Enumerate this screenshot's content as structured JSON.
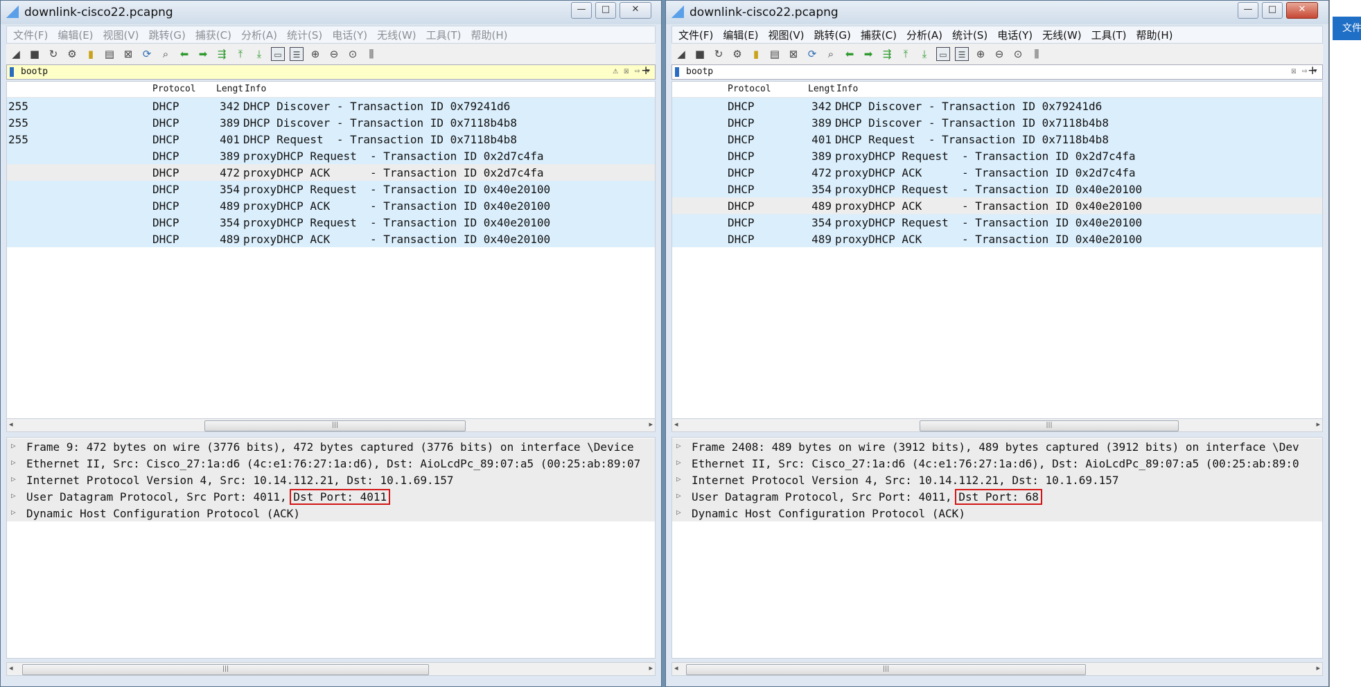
{
  "left": {
    "title": "downlink-cisco22.pcapng",
    "menu": [
      "文件(F)",
      "编辑(E)",
      "视图(V)",
      "跳转(G)",
      "捕获(C)",
      "分析(A)",
      "统计(S)",
      "电话(Y)",
      "无线(W)",
      "工具(T)",
      "帮助(H)"
    ],
    "filter": "bootp",
    "columns": {
      "protocol": "Protocol",
      "length": "Lengt",
      "info": "Info"
    },
    "rows": [
      {
        "c0": "255",
        "proto": "DHCP",
        "len": "342",
        "info": "DHCP Discover - Transaction ID 0x79241d6"
      },
      {
        "c0": "255",
        "proto": "DHCP",
        "len": "389",
        "info": "DHCP Discover - Transaction ID 0x7118b4b8"
      },
      {
        "c0": "255",
        "proto": "DHCP",
        "len": "401",
        "info": "DHCP Request  - Transaction ID 0x7118b4b8"
      },
      {
        "c0": "",
        "proto": "DHCP",
        "len": "389",
        "info": "proxyDHCP Request  - Transaction ID 0x2d7c4fa"
      },
      {
        "c0": "",
        "proto": "DHCP",
        "len": "472",
        "info": "proxyDHCP ACK      - Transaction ID 0x2d7c4fa"
      },
      {
        "c0": "",
        "proto": "DHCP",
        "len": "354",
        "info": "proxyDHCP Request  - Transaction ID 0x40e20100"
      },
      {
        "c0": "",
        "proto": "DHCP",
        "len": "489",
        "info": "proxyDHCP ACK      - Transaction ID 0x40e20100"
      },
      {
        "c0": "",
        "proto": "DHCP",
        "len": "354",
        "info": "proxyDHCP Request  - Transaction ID 0x40e20100"
      },
      {
        "c0": "",
        "proto": "DHCP",
        "len": "489",
        "info": "proxyDHCP ACK      - Transaction ID 0x40e20100"
      }
    ],
    "details": {
      "frame": "Frame 9: 472 bytes on wire (3776 bits), 472 bytes captured (3776 bits) on interface \\Device",
      "ethernet": "Ethernet II, Src: Cisco_27:1a:d6 (4c:e1:76:27:1a:d6), Dst: AioLcdPc_89:07:a5 (00:25:ab:89:07",
      "ip": "Internet Protocol Version 4, Src: 10.14.112.21, Dst: 10.1.69.157",
      "udp": "User Datagram Protocol, Src Port: 4011, ",
      "udp_dst": "Dst Port: 4011",
      "dhcp": "Dynamic Host Configuration Protocol (ACK)"
    }
  },
  "right": {
    "title": "downlink-cisco22.pcapng",
    "menu": [
      "文件(F)",
      "编辑(E)",
      "视图(V)",
      "跳转(G)",
      "捕获(C)",
      "分析(A)",
      "统计(S)",
      "电话(Y)",
      "无线(W)",
      "工具(T)",
      "帮助(H)"
    ],
    "filter": "bootp",
    "columns": {
      "protocol": "Protocol",
      "length": "Lengt",
      "info": "Info"
    },
    "rows": [
      {
        "proto": "DHCP",
        "len": "342",
        "info": "DHCP Discover - Transaction ID 0x79241d6"
      },
      {
        "proto": "DHCP",
        "len": "389",
        "info": "DHCP Discover - Transaction ID 0x7118b4b8"
      },
      {
        "proto": "DHCP",
        "len": "401",
        "info": "DHCP Request  - Transaction ID 0x7118b4b8"
      },
      {
        "proto": "DHCP",
        "len": "389",
        "info": "proxyDHCP Request  - Transaction ID 0x2d7c4fa"
      },
      {
        "proto": "DHCP",
        "len": "472",
        "info": "proxyDHCP ACK      - Transaction ID 0x2d7c4fa"
      },
      {
        "proto": "DHCP",
        "len": "354",
        "info": "proxyDHCP Request  - Transaction ID 0x40e20100"
      },
      {
        "proto": "DHCP",
        "len": "489",
        "info": "proxyDHCP ACK      - Transaction ID 0x40e20100"
      },
      {
        "proto": "DHCP",
        "len": "354",
        "info": "proxyDHCP Request  - Transaction ID 0x40e20100"
      },
      {
        "proto": "DHCP",
        "len": "489",
        "info": "proxyDHCP ACK      - Transaction ID 0x40e20100"
      }
    ],
    "details": {
      "frame": "Frame 2408: 489 bytes on wire (3912 bits), 489 bytes captured (3912 bits) on interface \\Dev",
      "ethernet": "Ethernet II, Src: Cisco_27:1a:d6 (4c:e1:76:27:1a:d6), Dst: AioLcdPc_89:07:a5 (00:25:ab:89:0",
      "ip": "Internet Protocol Version 4, Src: 10.14.112.21, Dst: 10.1.69.157",
      "udp": "User Datagram Protocol, Src Port: 4011, ",
      "udp_dst": "Dst Port: 68",
      "dhcp": "Dynamic Host Configuration Protocol (ACK)"
    }
  },
  "side": {
    "tab": "文件"
  }
}
